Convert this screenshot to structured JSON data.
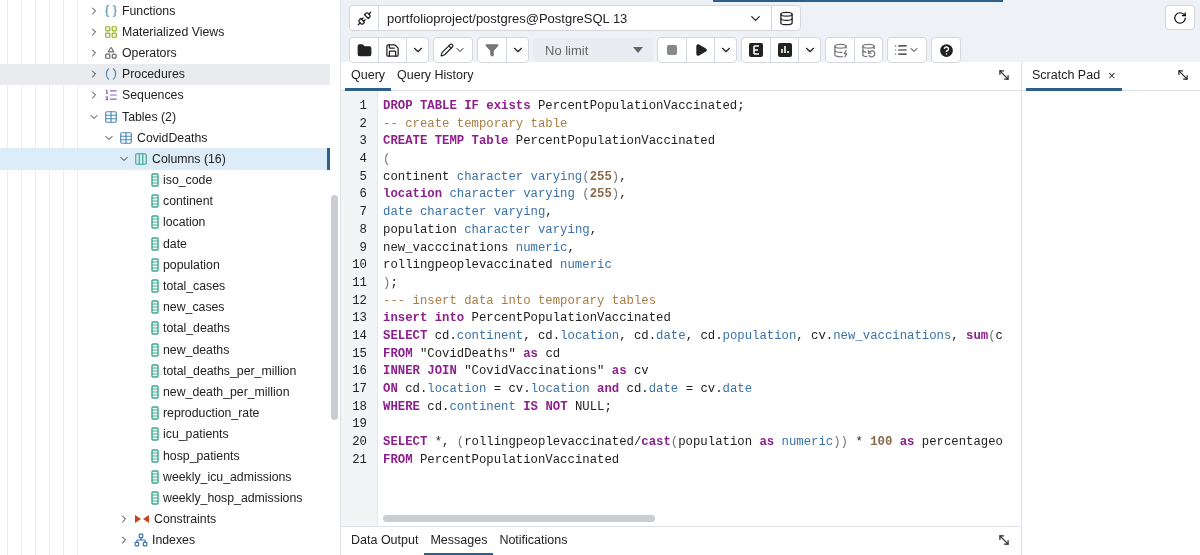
{
  "tree": {
    "items": [
      {
        "label": "Functions",
        "kind": "function",
        "expanded": false,
        "selected": false,
        "hovered": false
      },
      {
        "label": "Materialized Views",
        "kind": "matview",
        "expanded": false,
        "selected": false,
        "hovered": false
      },
      {
        "label": "Operators",
        "kind": "operator",
        "expanded": false,
        "selected": false,
        "hovered": false
      },
      {
        "label": "Procedures",
        "kind": "procedure",
        "expanded": false,
        "selected": false,
        "hovered": true
      },
      {
        "label": "Sequences",
        "kind": "sequence",
        "expanded": false,
        "selected": false,
        "hovered": false
      },
      {
        "label": "Tables (2)",
        "kind": "tables",
        "expanded": true,
        "selected": false,
        "hovered": false,
        "children": [
          {
            "label": "CovidDeaths",
            "kind": "table",
            "expanded": true,
            "selected": false,
            "hovered": false,
            "children": [
              {
                "label": "Columns (16)",
                "kind": "columns",
                "expanded": true,
                "selected": true,
                "hovered": false,
                "children": [
                  {
                    "label": "iso_code",
                    "kind": "column",
                    "selected": false,
                    "hovered": false
                  },
                  {
                    "label": "continent",
                    "kind": "column",
                    "selected": false,
                    "hovered": false
                  },
                  {
                    "label": "location",
                    "kind": "column",
                    "selected": false,
                    "hovered": false
                  },
                  {
                    "label": "date",
                    "kind": "column",
                    "selected": false,
                    "hovered": false
                  },
                  {
                    "label": "population",
                    "kind": "column",
                    "selected": false,
                    "hovered": false
                  },
                  {
                    "label": "total_cases",
                    "kind": "column",
                    "selected": false,
                    "hovered": false
                  },
                  {
                    "label": "new_cases",
                    "kind": "column",
                    "selected": false,
                    "hovered": false
                  },
                  {
                    "label": "total_deaths",
                    "kind": "column",
                    "selected": false,
                    "hovered": false
                  },
                  {
                    "label": "new_deaths",
                    "kind": "column",
                    "selected": false,
                    "hovered": false
                  },
                  {
                    "label": "total_deaths_per_million",
                    "kind": "column",
                    "selected": false,
                    "hovered": false
                  },
                  {
                    "label": "new_death_per_million",
                    "kind": "column",
                    "selected": false,
                    "hovered": false
                  },
                  {
                    "label": "reproduction_rate",
                    "kind": "column",
                    "selected": false,
                    "hovered": false
                  },
                  {
                    "label": "icu_patients",
                    "kind": "column",
                    "selected": false,
                    "hovered": false
                  },
                  {
                    "label": "hosp_patients",
                    "kind": "column",
                    "selected": false,
                    "hovered": false
                  },
                  {
                    "label": "weekly_icu_admissions",
                    "kind": "column",
                    "selected": false,
                    "hovered": false
                  },
                  {
                    "label": "weekly_hosp_admissions",
                    "kind": "column",
                    "selected": false,
                    "hovered": false
                  }
                ]
              },
              {
                "label": "Constraints",
                "kind": "constraint",
                "expanded": false,
                "selected": false,
                "hovered": false
              },
              {
                "label": "Indexes",
                "kind": "index",
                "expanded": false,
                "selected": false,
                "hovered": false
              }
            ]
          }
        ]
      }
    ]
  },
  "connection": {
    "label": "portfolioproject/postgres@PostgreSQL 13"
  },
  "toolbar": {
    "limit": "No limit"
  },
  "query_tabs": [
    {
      "label": "Query",
      "selected": true
    },
    {
      "label": "Query History",
      "selected": false
    }
  ],
  "scratch_tab": {
    "label": "Scratch Pad",
    "close": "×",
    "selected": true
  },
  "editor": {
    "lines": [
      {
        "number": "1",
        "tokens": [
          {
            "kind": "keyword",
            "text": "DROP TABLE IF exists"
          },
          {
            "kind": "plain",
            "text": " PercentPopulationVaccinated;"
          }
        ]
      },
      {
        "number": "2",
        "tokens": [
          {
            "kind": "comment",
            "text": "-- create temporary table"
          }
        ]
      },
      {
        "number": "3",
        "tokens": [
          {
            "kind": "keyword",
            "text": "CREATE TEMP Table"
          },
          {
            "kind": "plain",
            "text": " PercentPopulationVaccinated"
          }
        ]
      },
      {
        "number": "4",
        "tokens": [
          {
            "kind": "punct",
            "text": "("
          }
        ]
      },
      {
        "number": "5",
        "tokens": [
          {
            "kind": "plain",
            "text": "continent "
          },
          {
            "kind": "type",
            "text": "character varying"
          },
          {
            "kind": "punct",
            "text": "("
          },
          {
            "kind": "number",
            "text": "255"
          },
          {
            "kind": "punct",
            "text": ")"
          },
          {
            "kind": "plain",
            "text": ","
          }
        ]
      },
      {
        "number": "6",
        "tokens": [
          {
            "kind": "keyword",
            "text": "location"
          },
          {
            "kind": "type",
            "text": " character varying"
          },
          {
            "kind": "punct",
            "text": " ("
          },
          {
            "kind": "number",
            "text": "255"
          },
          {
            "kind": "punct",
            "text": ")"
          },
          {
            "kind": "plain",
            "text": ","
          }
        ]
      },
      {
        "number": "7",
        "tokens": [
          {
            "kind": "type",
            "text": "date character varying"
          },
          {
            "kind": "plain",
            "text": ","
          }
        ]
      },
      {
        "number": "8",
        "tokens": [
          {
            "kind": "plain",
            "text": "population "
          },
          {
            "kind": "type",
            "text": "character varying"
          },
          {
            "kind": "plain",
            "text": ","
          }
        ]
      },
      {
        "number": "9",
        "tokens": [
          {
            "kind": "plain",
            "text": "new_vacccinations "
          },
          {
            "kind": "type",
            "text": "numeric"
          },
          {
            "kind": "plain",
            "text": ","
          }
        ]
      },
      {
        "number": "10",
        "tokens": [
          {
            "kind": "plain",
            "text": "rollingpeoplevaccinated "
          },
          {
            "kind": "type",
            "text": "numeric"
          }
        ]
      },
      {
        "number": "11",
        "tokens": [
          {
            "kind": "punct",
            "text": ")"
          },
          {
            "kind": "plain",
            "text": ";"
          }
        ]
      },
      {
        "number": "12",
        "tokens": [
          {
            "kind": "comment",
            "text": "--- insert data into temporary tables"
          }
        ]
      },
      {
        "number": "13",
        "tokens": [
          {
            "kind": "keyword",
            "text": "insert into"
          },
          {
            "kind": "plain",
            "text": " PercentPopulationVaccinated"
          }
        ]
      },
      {
        "number": "14",
        "tokens": [
          {
            "kind": "keyword",
            "text": "SELECT"
          },
          {
            "kind": "plain",
            "text": " cd."
          },
          {
            "kind": "type",
            "text": "continent"
          },
          {
            "kind": "plain",
            "text": ", cd."
          },
          {
            "kind": "type",
            "text": "location"
          },
          {
            "kind": "plain",
            "text": ", cd."
          },
          {
            "kind": "type",
            "text": "date"
          },
          {
            "kind": "plain",
            "text": ", cd."
          },
          {
            "kind": "type",
            "text": "population"
          },
          {
            "kind": "plain",
            "text": ", cv."
          },
          {
            "kind": "type",
            "text": "new_vaccinations"
          },
          {
            "kind": "plain",
            "text": ", "
          },
          {
            "kind": "keyword",
            "text": "sum"
          },
          {
            "kind": "punct",
            "text": "("
          },
          {
            "kind": "plain",
            "text": "c"
          }
        ]
      },
      {
        "number": "15",
        "tokens": [
          {
            "kind": "keyword",
            "text": "FROM"
          },
          {
            "kind": "plain",
            "text": " \"CovidDeaths\" "
          },
          {
            "kind": "keyword",
            "text": "as"
          },
          {
            "kind": "plain",
            "text": " cd"
          }
        ]
      },
      {
        "number": "16",
        "tokens": [
          {
            "kind": "keyword",
            "text": "INNER JOIN"
          },
          {
            "kind": "plain",
            "text": " \"CovidVaccinations\" "
          },
          {
            "kind": "keyword",
            "text": "as"
          },
          {
            "kind": "plain",
            "text": " cv"
          }
        ]
      },
      {
        "number": "17",
        "tokens": [
          {
            "kind": "keyword",
            "text": "ON"
          },
          {
            "kind": "plain",
            "text": " cd."
          },
          {
            "kind": "type",
            "text": "location"
          },
          {
            "kind": "plain",
            "text": " = cv."
          },
          {
            "kind": "type",
            "text": "location"
          },
          {
            "kind": "keyword",
            "text": " and"
          },
          {
            "kind": "plain",
            "text": " cd."
          },
          {
            "kind": "type",
            "text": "date"
          },
          {
            "kind": "plain",
            "text": " = cv."
          },
          {
            "kind": "type",
            "text": "date"
          }
        ]
      },
      {
        "number": "18",
        "tokens": [
          {
            "kind": "keyword",
            "text": "WHERE"
          },
          {
            "kind": "plain",
            "text": " cd."
          },
          {
            "kind": "type",
            "text": "continent"
          },
          {
            "kind": "keyword",
            "text": " IS NOT"
          },
          {
            "kind": "plain",
            "text": " NULL;"
          }
        ]
      },
      {
        "number": "19"
      },
      {
        "number": "20",
        "tokens": [
          {
            "kind": "keyword",
            "text": "SELECT"
          },
          {
            "kind": "plain",
            "text": " *, "
          },
          {
            "kind": "punct",
            "text": "("
          },
          {
            "kind": "plain",
            "text": "rollingpeoplevaccinated/"
          },
          {
            "kind": "keyword",
            "text": "cast"
          },
          {
            "kind": "punct",
            "text": "("
          },
          {
            "kind": "plain",
            "text": "population "
          },
          {
            "kind": "keyword",
            "text": "as"
          },
          {
            "kind": "type",
            "text": " numeric"
          },
          {
            "kind": "punct",
            "text": "))"
          },
          {
            "kind": "plain",
            "text": " * "
          },
          {
            "kind": "number",
            "text": "100"
          },
          {
            "kind": "keyword",
            "text": " as"
          },
          {
            "kind": "plain",
            "text": " percentageo"
          }
        ]
      },
      {
        "number": "21",
        "tokens": [
          {
            "kind": "keyword",
            "text": "FROM"
          },
          {
            "kind": "plain",
            "text": " PercentPopulationVaccinated"
          }
        ]
      }
    ]
  },
  "output_tabs": [
    {
      "label": "Data Output",
      "selected": false
    },
    {
      "label": "Messages",
      "selected": true
    },
    {
      "label": "Notifications",
      "selected": false
    }
  ]
}
